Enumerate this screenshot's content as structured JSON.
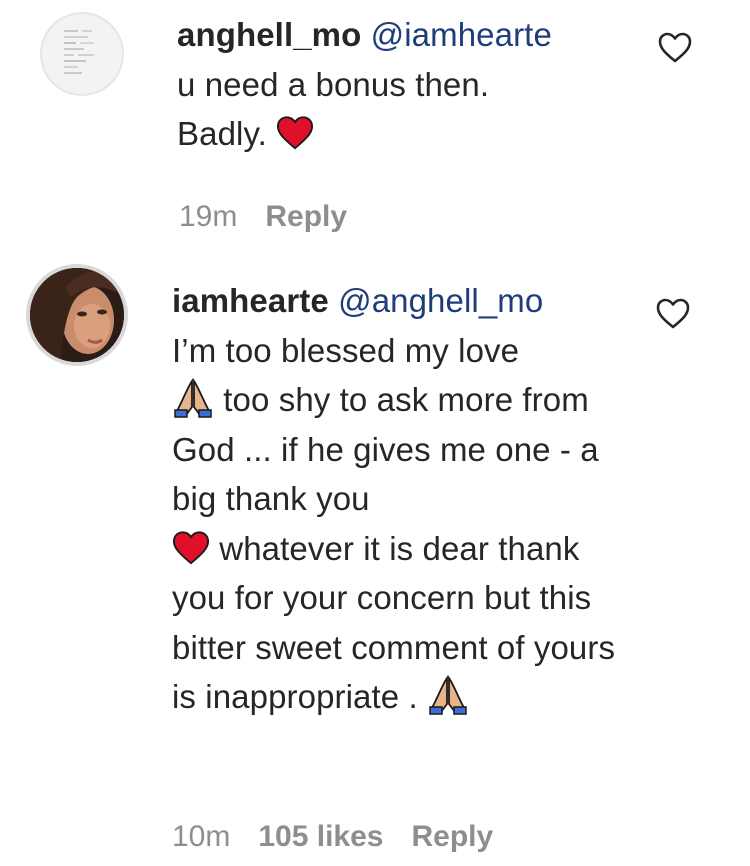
{
  "comments": [
    {
      "username": "anghell_mo",
      "mention": "@iamhearte",
      "line1": "u need a bonus then.",
      "line2": "Badly.",
      "time": "19m",
      "reply_label": "Reply",
      "avatar_icon": "text-image-avatar",
      "like_icon": "heart-outline-icon"
    },
    {
      "username": "iamhearte",
      "mention": "@anghell_mo",
      "text_a": "I’m too blessed my love",
      "text_b": "too shy to ask more from God ... if he gives me one - a big thank you",
      "text_c": "whatever it is dear thank you for your concern but this bitter sweet comment of yours is inappropriate .",
      "time": "10m",
      "likes": "105 likes",
      "reply_label": "Reply",
      "avatar_icon": "profile-photo-avatar",
      "like_icon": "heart-outline-icon"
    }
  ],
  "colors": {
    "text": "#262626",
    "mention": "#1f3d7a",
    "meta": "#8e8e8e",
    "heart_emoji": "#e0102a",
    "pray_emoji": "#e8b48a"
  }
}
